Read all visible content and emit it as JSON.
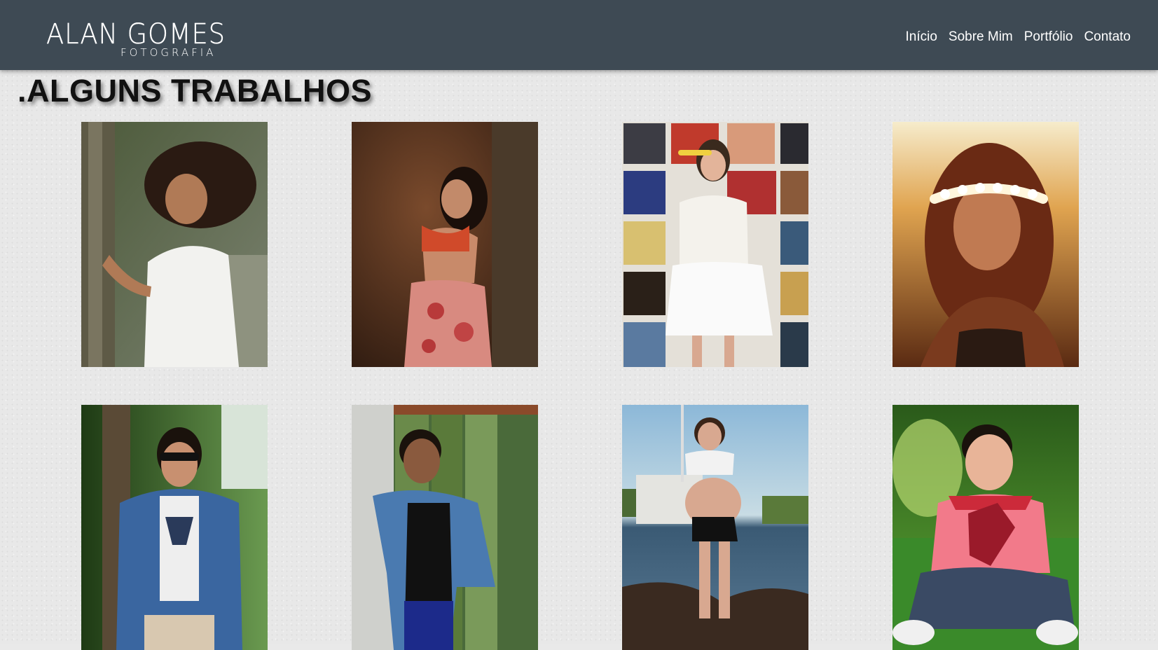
{
  "brand": {
    "name": "ALAN GOMES",
    "tagline": "FOTOGRAFIA"
  },
  "nav": {
    "items": [
      {
        "label": "Início"
      },
      {
        "label": "Sobre Mim"
      },
      {
        "label": "Portfólio"
      },
      {
        "label": "Contato"
      }
    ]
  },
  "section": {
    "title": ".ALGUNS TRABALHOS"
  },
  "colors": {
    "navbar": "#3e4a54",
    "page_background": "#e8e8e8",
    "title_text": "#111111",
    "nav_text": "#ffffff"
  },
  "gallery": {
    "photos": [
      {
        "subject": "portrait-curly-hair-woman-white-shirt-tree"
      },
      {
        "subject": "maternity-forest-orange-bikini-floral-skirt"
      },
      {
        "subject": "woman-flower-crown-white-dress-record-wall"
      },
      {
        "subject": "woman-flower-crown-sunset-portrait"
      },
      {
        "subject": "young-man-sunglasses-denim-jacket"
      },
      {
        "subject": "young-man-denim-jacket-wooden-door"
      },
      {
        "subject": "maternity-beach-rocks-boat"
      },
      {
        "subject": "baby-boy-grass-red-flower"
      }
    ]
  }
}
